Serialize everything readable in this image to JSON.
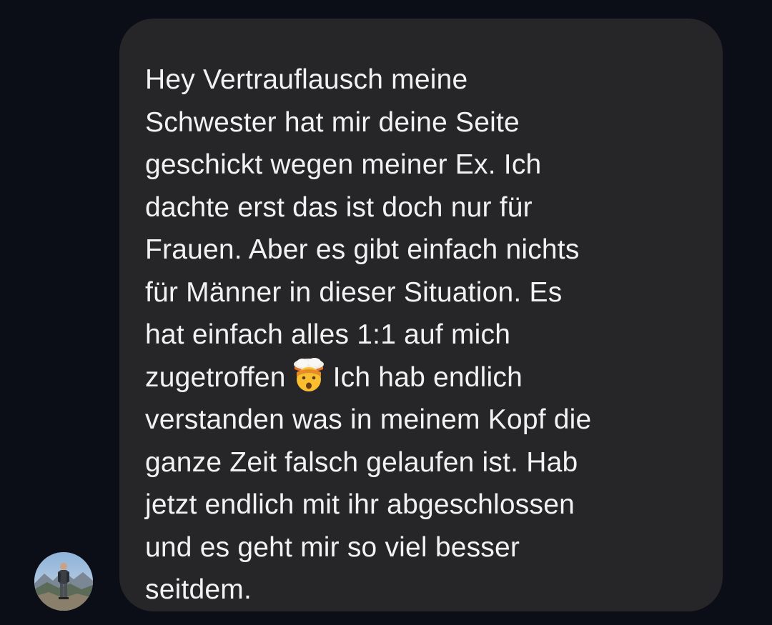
{
  "message": {
    "text_before_emoji": "Hey Vertrauflausch meine\nSchwester hat mir deine Seite\ngeschickt wegen meiner Ex. Ich\ndachte erst das ist doch nur für\nFrauen. Aber es gibt einfach nichts\nfür Männer in dieser Situation. Es\nhat einfach alles 1:1 auf mich\nzugetroffen",
    "emoji": "exploding-head-emoji",
    "text_after_emoji": "Ich hab endlich\nverstanden was in meinem Kopf die\nganze Zeit falsch gelaufen ist. Hab\njetzt endlich mit ihr abgeschlossen\nund es geht mir so viel besser\nseitdem."
  },
  "sender": {
    "avatar": "profile-photo-hiker-mountains"
  },
  "colors": {
    "background": "#0b0d17",
    "bubble": "#262629",
    "text": "#f2f2f2"
  }
}
